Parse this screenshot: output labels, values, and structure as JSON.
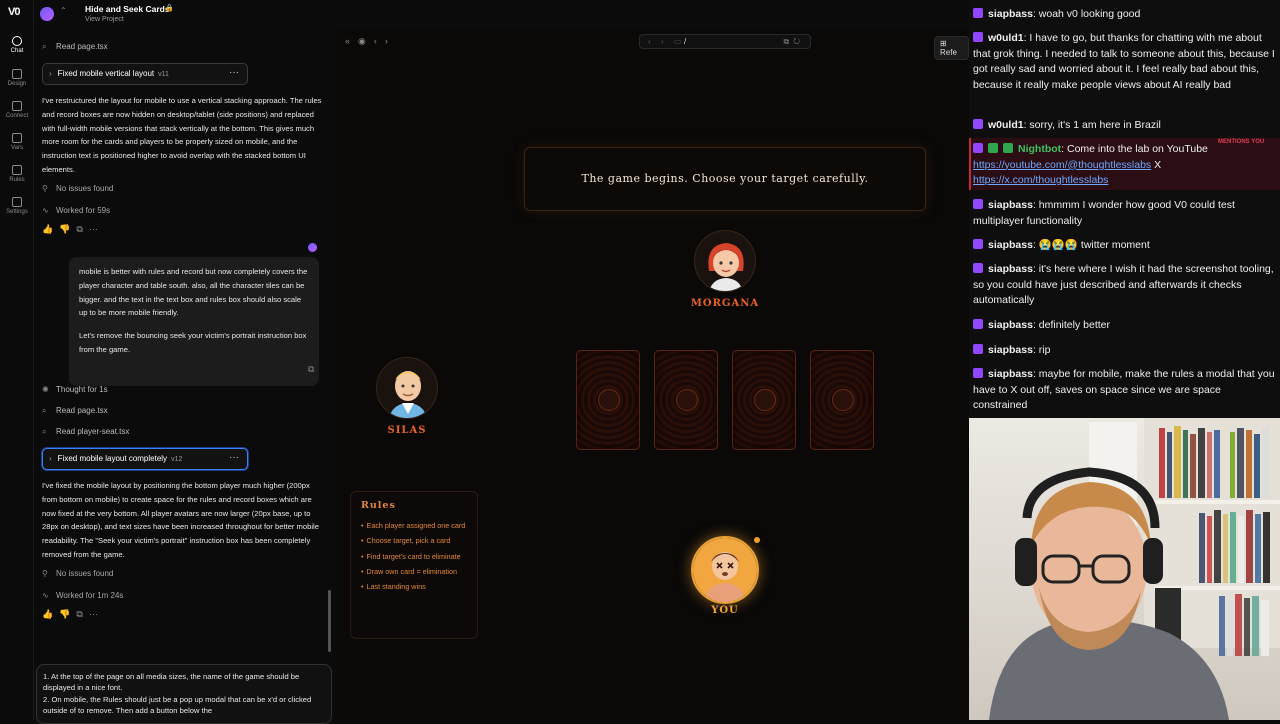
{
  "app": {
    "logo": "V0",
    "project_title": "Hide and Seek Cards",
    "project_sub": "View Project",
    "lock_icon": "lock-icon"
  },
  "rail": [
    {
      "label": "Chat",
      "icon": "chat-icon"
    },
    {
      "label": "Design",
      "icon": "design-icon"
    },
    {
      "label": "Connect",
      "icon": "connect-icon"
    },
    {
      "label": "Vars",
      "icon": "vars-icon"
    },
    {
      "label": "Rules",
      "icon": "rules-icon"
    },
    {
      "label": "Settings",
      "icon": "settings-icon"
    }
  ],
  "chat": {
    "read1": "Read page.tsx",
    "v11": {
      "title": "Fixed mobile vertical layout",
      "version": "v11"
    },
    "para1": "I've restructured the layout for mobile to use a vertical stacking approach. The rules and record boxes are now hidden on desktop/tablet (side positions) and replaced with full-width mobile versions that stack vertically at the bottom. This gives much more room for the cards and players to be properly sized on mobile, and the instruction text is positioned higher to avoid overlap with the stacked bottom UI elements.",
    "no_issues1": "No issues found",
    "worked1": "Worked for 59s",
    "user_p1": "mobile is better with rules and record but now completely covers the player character and table south. also, all the character tiles can be bigger. and the text in the text box and rules box should also scale up to be more mobile friendly.",
    "user_p2": "Let's remove the bouncing seek your victim's portrait instruction box from the game.",
    "thought": "Thought for 1s",
    "read2": "Read page.tsx",
    "read3": "Read player-seat.tsx",
    "v12": {
      "title": "Fixed mobile layout completely",
      "version": "v12"
    },
    "para2": "I've fixed the mobile layout by positioning the bottom player much higher (200px from bottom on mobile) to create space for the rules and record boxes which are now fixed at the very bottom. All player avatars are now larger (20px base, up to 28px on desktop), and text sizes have been increased throughout for better mobile readability. The \"Seek your victim's portrait\" instruction box has been completely removed from the game.",
    "no_issues2": "No issues found",
    "worked2": "Worked for 1m 24s",
    "composer_l1": "1. At the top of the page on all media sizes, the name of the game should be displayed in a nice font.",
    "composer_l2": "2. On mobile, the Rules should just be a pop up modal that can be x'd or clicked outside of to remove. Then add a button below the"
  },
  "preview": {
    "url_path": "/",
    "refresh_btn": "Refe",
    "banner": "The game begins. Choose your target carefully.",
    "players": {
      "top": "MORGANA",
      "left": "SILAS",
      "bottom": "YOU"
    },
    "rules_title": "Rules",
    "rules": [
      "Each player assigned one card",
      "Choose target, pick a card",
      "Find target's card to eliminate",
      "Draw own card = elimination",
      "Last standing wins"
    ],
    "colors": {
      "accent": "#e8631f",
      "rules": "#e2893a",
      "gold": "#e8a232"
    }
  },
  "stream_chat": [
    {
      "user": "siapbass",
      "text": ": woah v0 looking good"
    },
    {
      "user": "w0uld1",
      "text": ": I have to go, but thanks for chatting with me about that grok thing. I needed to talk to someone about this, because I got really sad and worried about it. I feel really bad about this, because it really make people views about AI really bad"
    },
    {
      "user": "w0uld1",
      "text": ": sorry, it's 1 am here in Brazil"
    },
    {
      "user": "Nightbot",
      "text": ": Come into the lab on YouTube ",
      "link1": "https://youtube.com/@thoughtlesslabs",
      "sep": " X ",
      "link2": "https://x.com/thoughtlesslabs",
      "mention": "MENTIONS YOU"
    },
    {
      "user": "siapbass",
      "text": ": hmmmm I wonder how good V0 could test multiplayer functionality"
    },
    {
      "user": "siapbass",
      "text": ": 😭😭😭 twitter moment"
    },
    {
      "user": "siapbass",
      "text": ": it's here where I wish it had the screenshot tooling, so you could have just described and afterwards it checks automatically"
    },
    {
      "user": "siapbass",
      "text": ": definitely better"
    },
    {
      "user": "siapbass",
      "text": ": rip"
    },
    {
      "user": "siapbass",
      "text": ": maybe for mobile, make the rules a modal that you have to X out off, saves on space since we are space constrained"
    }
  ]
}
